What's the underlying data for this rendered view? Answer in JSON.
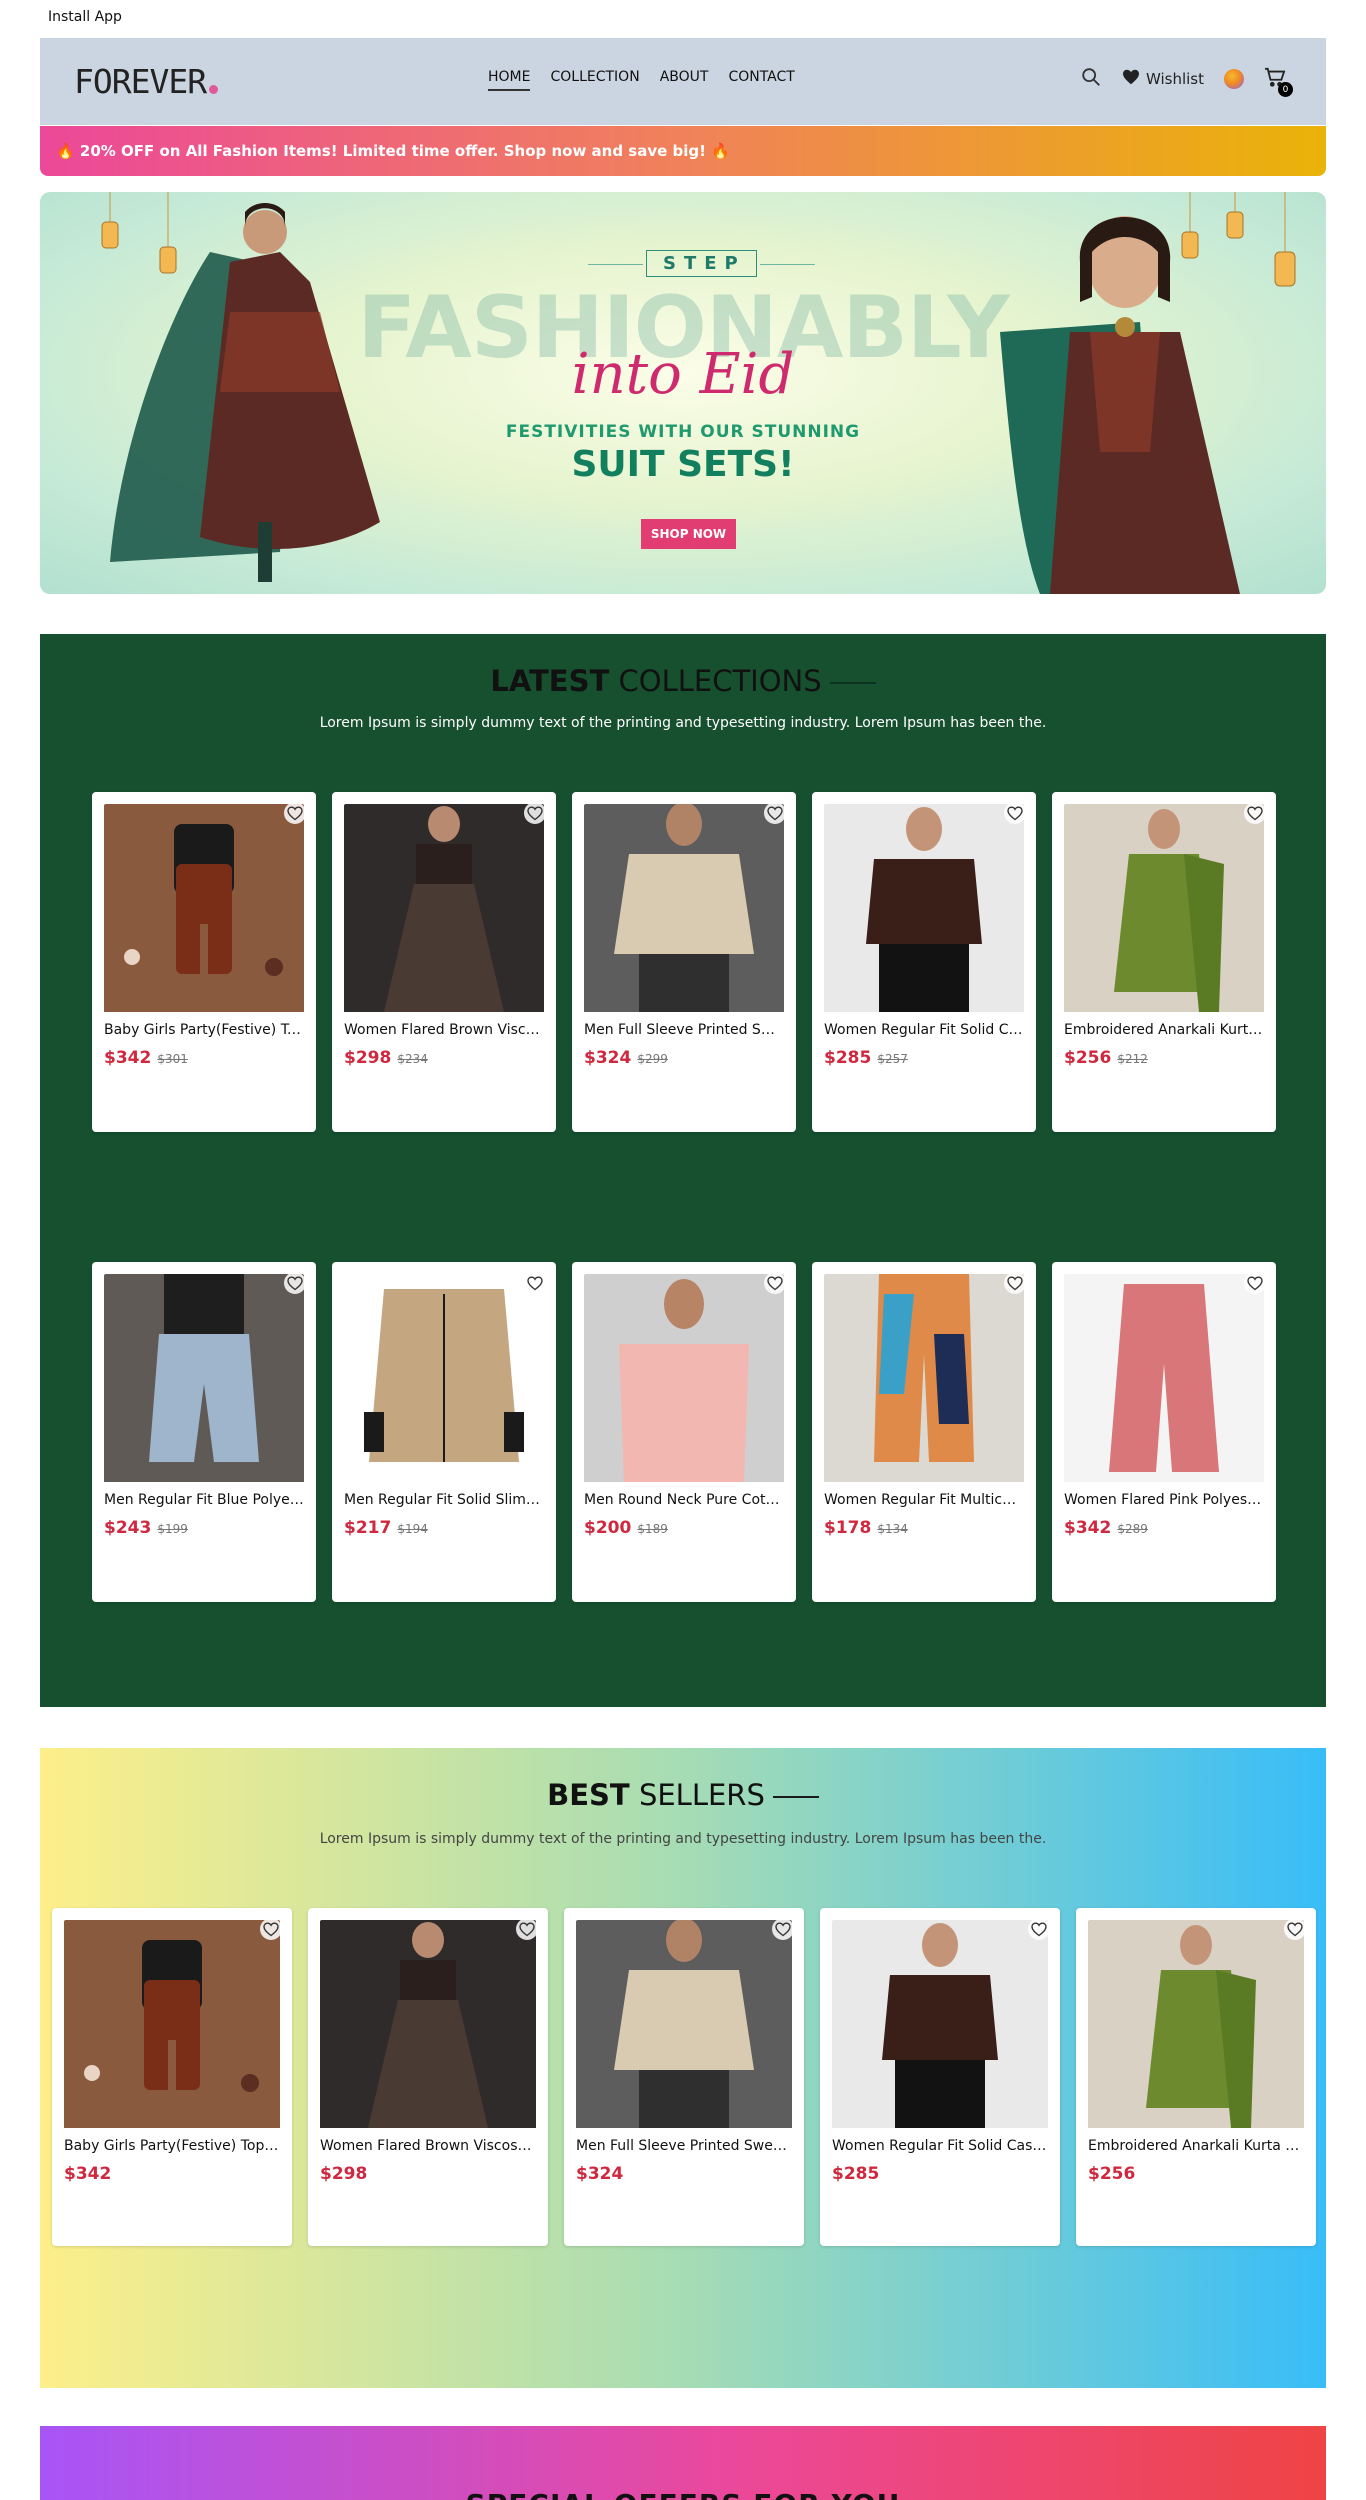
{
  "install_label": "Install App",
  "nav": {
    "logo": "FOREVER",
    "menu": [
      "HOME",
      "COLLECTION",
      "ABOUT",
      "CONTACT"
    ],
    "wishlist": "Wishlist",
    "cart_count": "0"
  },
  "promo": "🔥 20% OFF on All Fashion Items! Limited time offer. Shop now and save big! 🔥",
  "hero": {
    "step": "STEP",
    "big": "FASHIONABLY",
    "script": "into Eid",
    "sub": "FESTIVITIES WITH OUR STUNNING",
    "head": "SUIT SETS!",
    "button": "SHOP NOW"
  },
  "latest": {
    "title_bold": "LATEST",
    "title_rest": "COLLECTIONS",
    "subtitle": "Lorem Ipsum is simply dummy text of the printing and typesetting industry. Lorem Ipsum has been the.",
    "products": [
      {
        "name": "Baby Girls Party(Festive) Top and Pant Set",
        "price": "$342",
        "old": "$301"
      },
      {
        "name": "Women Flared Brown Viscose Rayon Skirt",
        "price": "$298",
        "old": "$234"
      },
      {
        "name": "Men Full Sleeve Printed Sweatshirt",
        "price": "$324",
        "old": "$299"
      },
      {
        "name": "Women Regular Fit Solid Casual Shirt",
        "price": "$285",
        "old": "$257"
      },
      {
        "name": "Embroidered Anarkali Kurta Set",
        "price": "$256",
        "old": "$212"
      },
      {
        "name": "Men Regular Fit Blue Polyester Trousers",
        "price": "$243",
        "old": "$199"
      },
      {
        "name": "Men Regular Fit Solid Slim Collar Shirt",
        "price": "$217",
        "old": "$194"
      },
      {
        "name": "Men Round Neck Pure Cotton T-Shirt",
        "price": "$200",
        "old": "$189"
      },
      {
        "name": "Women Regular Fit Multicolor Trousers",
        "price": "$178",
        "old": "$134"
      },
      {
        "name": "Women Flared Pink Polyester Trousers",
        "price": "$342",
        "old": "$289"
      }
    ]
  },
  "best": {
    "title_bold": "BEST",
    "title_rest": "SELLERS",
    "subtitle": "Lorem Ipsum is simply dummy text of the printing and typesetting industry. Lorem Ipsum has been the.",
    "products": [
      {
        "name": "Baby Girls Party(Festive) Top and Pant Set",
        "price": "$342"
      },
      {
        "name": "Women Flared Brown Viscose Rayon Skirt",
        "price": "$298"
      },
      {
        "name": "Men Full Sleeve Printed Sweatshirt",
        "price": "$324"
      },
      {
        "name": "Women Regular Fit Solid Casual Shirt",
        "price": "$285"
      },
      {
        "name": "Embroidered Anarkali Kurta Set",
        "price": "$256"
      }
    ]
  },
  "special": {
    "title": "SPECIAL OFFERS FOR YOU"
  },
  "colors": {
    "latest_bg": "#16502f",
    "price": "#d0283e",
    "promo_start": "#ec4899",
    "promo_end": "#eab308"
  }
}
